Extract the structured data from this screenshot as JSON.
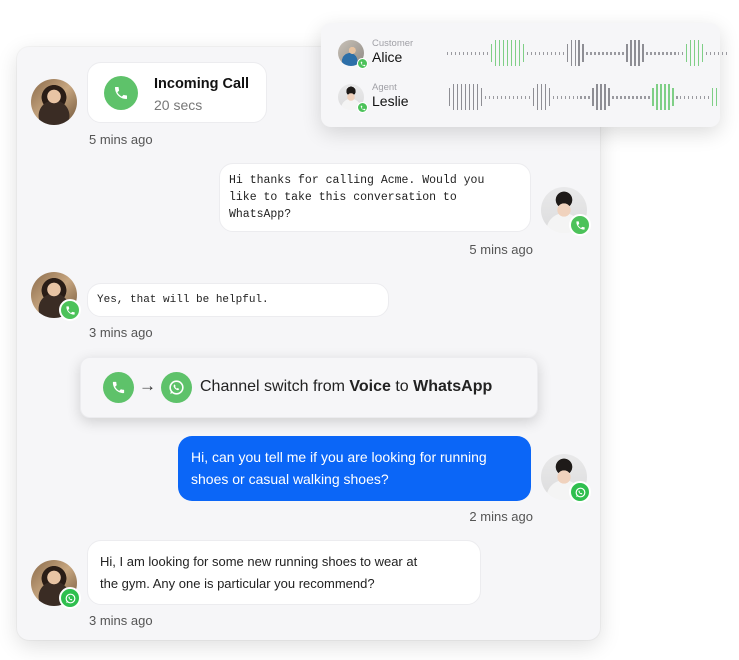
{
  "participants_card": {
    "customer": {
      "role_label": "Customer",
      "name": "Alice",
      "channel_badge": "phone-icon"
    },
    "agent": {
      "role_label": "Agent",
      "name": "Leslie",
      "channel_badge": "phone-icon"
    },
    "colors": {
      "active_wave": "#7fcf86",
      "inactive_wave": "#8e8e94",
      "idle_wave": "#9a9aa0"
    }
  },
  "conversation": {
    "incoming_call": {
      "title": "Incoming Call",
      "duration": "20 secs",
      "time": "5 mins ago"
    },
    "messages": [
      {
        "sender": "agent",
        "channel": "voice",
        "text_lines": [
          "Hi thanks for calling Acme. Would you",
          "like to take this conversation to",
          "WhatsApp?"
        ],
        "time": "5 mins ago"
      },
      {
        "sender": "customer",
        "channel": "voice",
        "text_lines": [
          "Yes, that will be helpful."
        ],
        "time": "3 mins ago"
      },
      {
        "sender": "agent",
        "channel": "whatsapp",
        "text_lines": [
          "Hi, can you tell me if you are looking for running",
          "shoes or casual walking shoes?"
        ],
        "time": "2 mins ago"
      },
      {
        "sender": "customer",
        "channel": "whatsapp",
        "text_lines": [
          "Hi, I am looking for some new running shoes to wear at",
          "the gym. Any one is particular you recommend?"
        ],
        "time": "3 mins ago"
      }
    ],
    "channel_switch": {
      "prefix": "Channel switch from",
      "from": "Voice",
      "middle": "to",
      "to": "WhatsApp",
      "arrow": "→"
    }
  },
  "colors": {
    "whatsapp_green": "#4cc25a",
    "agent_bubble_blue": "#0b66f7",
    "panel_bg": "#f6f6f8"
  }
}
